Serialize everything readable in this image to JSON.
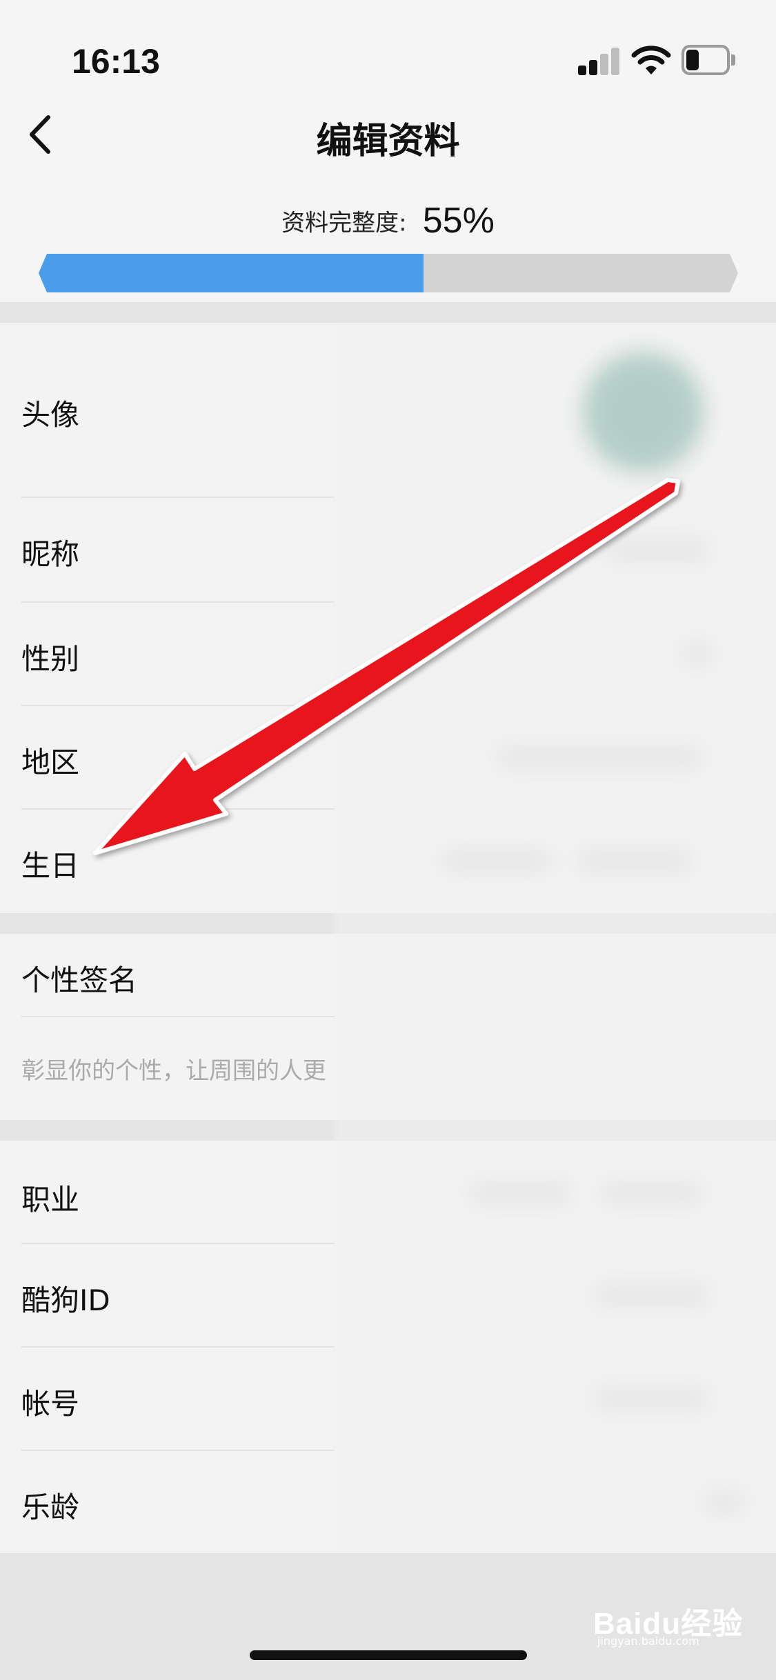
{
  "status_bar": {
    "time": "16:13"
  },
  "header": {
    "title": "编辑资料",
    "back_icon": "chevron-left-icon"
  },
  "completeness": {
    "label": "资料完整度:",
    "value": "55%",
    "progress": 0.55,
    "bar_color": "#4a9de8",
    "track_color": "#d3d3d3"
  },
  "profile_rows": [
    {
      "label": "头像"
    },
    {
      "label": "昵称"
    },
    {
      "label": "性别"
    },
    {
      "label": "地区"
    },
    {
      "label": "生日"
    }
  ],
  "signature": {
    "label": "个性签名",
    "placeholder": "彰显你的个性，让周围的人更"
  },
  "info_rows": [
    {
      "label": "职业"
    },
    {
      "label": "酷狗ID"
    },
    {
      "label": "帐号"
    },
    {
      "label": "乐龄"
    }
  ],
  "annotation": {
    "arrow_color": "#e8151a"
  },
  "watermark": {
    "text": "Baidu经验",
    "sub": "jingyan.baidu.com"
  }
}
